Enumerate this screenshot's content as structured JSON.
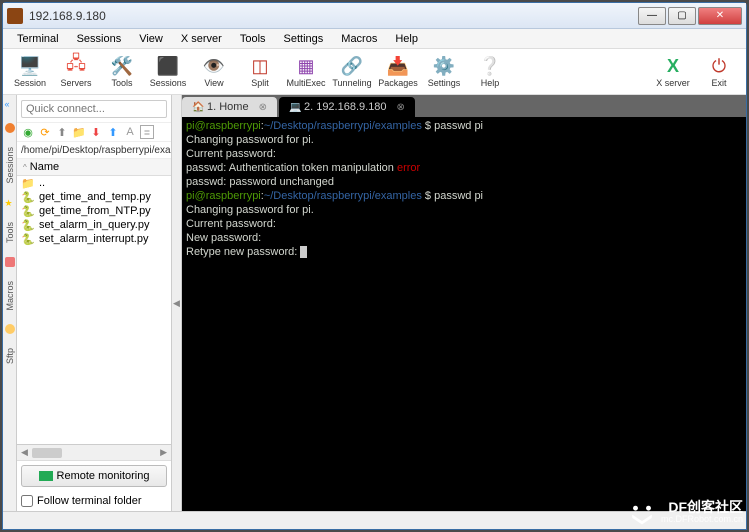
{
  "window": {
    "title": "192.168.9.180"
  },
  "menu": [
    "Terminal",
    "Sessions",
    "View",
    "X server",
    "Tools",
    "Settings",
    "Macros",
    "Help"
  ],
  "toolbar": {
    "session": "Session",
    "servers": "Servers",
    "tools": "Tools",
    "sessions": "Sessions",
    "view": "View",
    "split": "Split",
    "multiexec": "MultiExec",
    "tunneling": "Tunneling",
    "packages": "Packages",
    "settings": "Settings",
    "help": "Help",
    "xserver": "X server",
    "exit": "Exit"
  },
  "sidebar": {
    "placeholder": "Quick connect...",
    "breadcrumb": "/home/pi/Desktop/raspberrypi/exam",
    "name_header": "Name",
    "rail": [
      "Sessions",
      "Tools",
      "Macros",
      "Sftp"
    ],
    "files": [
      {
        "icon": "up",
        "label": ".."
      },
      {
        "icon": "py",
        "label": "get_time_and_temp.py"
      },
      {
        "icon": "py",
        "label": "get_time_from_NTP.py"
      },
      {
        "icon": "py",
        "label": "set_alarm_in_query.py"
      },
      {
        "icon": "py",
        "label": "set_alarm_interrupt.py"
      }
    ],
    "remote_btn": "Remote monitoring",
    "follow": "Follow terminal folder"
  },
  "tabs": [
    {
      "label": "1. Home",
      "active": false,
      "icon": "home"
    },
    {
      "label": "2. 192.168.9.180",
      "active": true,
      "icon": "term"
    }
  ],
  "terminal": {
    "lines": [
      {
        "segs": [
          {
            "t": "pi@raspberrypi",
            "c": "g"
          },
          {
            "t": ":",
            "c": "w"
          },
          {
            "t": "~/Desktop/raspberrypi/examples",
            "c": "b"
          },
          {
            "t": " $ passwd pi",
            "c": "w"
          }
        ]
      },
      {
        "segs": [
          {
            "t": "Changing password for pi.",
            "c": "w"
          }
        ]
      },
      {
        "segs": [
          {
            "t": "Current password:",
            "c": "w"
          }
        ]
      },
      {
        "segs": [
          {
            "t": "passwd: Authentication token manipulation ",
            "c": "w"
          },
          {
            "t": "error",
            "c": "r"
          }
        ]
      },
      {
        "segs": [
          {
            "t": "passwd: password unchanged",
            "c": "w"
          }
        ]
      },
      {
        "segs": [
          {
            "t": "pi@raspberrypi",
            "c": "g"
          },
          {
            "t": ":",
            "c": "w"
          },
          {
            "t": "~/Desktop/raspberrypi/examples",
            "c": "b"
          },
          {
            "t": " $ passwd pi",
            "c": "w"
          }
        ]
      },
      {
        "segs": [
          {
            "t": "Changing password for pi.",
            "c": "w"
          }
        ]
      },
      {
        "segs": [
          {
            "t": "Current password:",
            "c": "w"
          }
        ]
      },
      {
        "segs": [
          {
            "t": "New password:",
            "c": "w"
          }
        ]
      },
      {
        "segs": [
          {
            "t": "Retype new password: ",
            "c": "w"
          }
        ],
        "cursor": true
      }
    ]
  },
  "watermark": {
    "big": "DF创客社区",
    "small": "mc.DFRobot.com.cn"
  }
}
